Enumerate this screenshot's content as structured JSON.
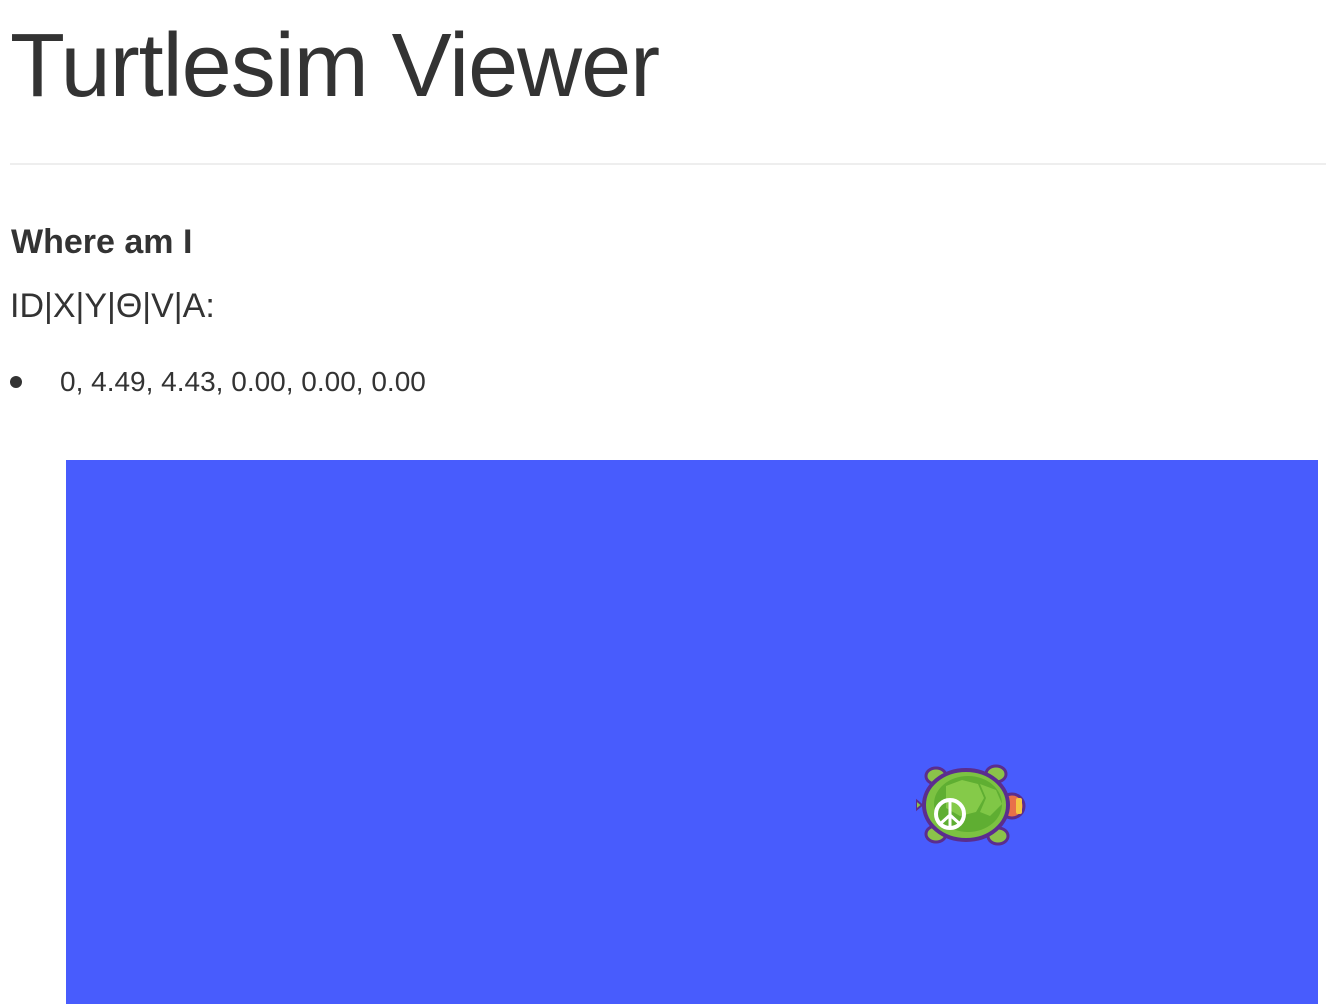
{
  "header": {
    "title": "Turtlesim Viewer"
  },
  "location": {
    "heading": "Where am I",
    "columns_label": "ID|X|Y|Θ|V|A:",
    "poses": [
      "0, 4.49, 4.43, 0.00, 0.00, 0.00"
    ]
  },
  "simulation": {
    "background_color": "#485cfd",
    "turtle_icon": "turtle-icon"
  }
}
